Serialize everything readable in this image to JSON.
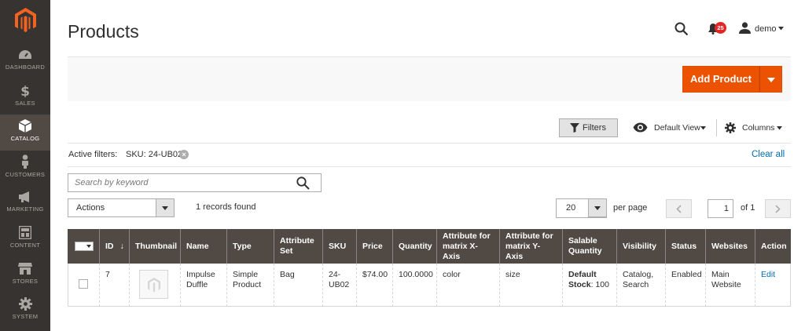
{
  "sidebar": {
    "items": [
      {
        "label": "DASHBOARD",
        "icon": "dashboard-icon"
      },
      {
        "label": "SALES",
        "icon": "dollar-icon"
      },
      {
        "label": "CATALOG",
        "icon": "cube-icon"
      },
      {
        "label": "CUSTOMERS",
        "icon": "person-icon"
      },
      {
        "label": "MARKETING",
        "icon": "megaphone-icon"
      },
      {
        "label": "CONTENT",
        "icon": "layout-icon"
      },
      {
        "label": "STORES",
        "icon": "store-icon"
      },
      {
        "label": "SYSTEM",
        "icon": "gear-icon"
      }
    ],
    "active": "CATALOG"
  },
  "header": {
    "title": "Products",
    "notifications_count": "25",
    "user_name": "demo"
  },
  "actionbar": {
    "add_label": "Add Product"
  },
  "toolbar": {
    "filters_label": "Filters",
    "view_label": "Default View",
    "columns_label": "Columns"
  },
  "active_filters": {
    "label": "Active filters:",
    "items": [
      "SKU: 24-UB02"
    ],
    "clear_label": "Clear all"
  },
  "search": {
    "placeholder": "Search by keyword",
    "value": ""
  },
  "mass_actions": {
    "label": "Actions"
  },
  "records_found": "1 records found",
  "pagination": {
    "per_page": "20",
    "per_page_label": "per page",
    "current_page": "1",
    "of_label": "of 1"
  },
  "table": {
    "columns": [
      "ID",
      "Thumbnail",
      "Name",
      "Type",
      "Attribute Set",
      "SKU",
      "Price",
      "Quantity",
      "Attribute for matrix X-Axis",
      "Attribute for matrix Y-Axis",
      "Salable Quantity",
      "Visibility",
      "Status",
      "Websites",
      "Action"
    ],
    "rows": [
      {
        "id": "7",
        "name": "Impulse Duffle",
        "type": "Simple Product",
        "attribute_set": "Bag",
        "sku": "24-UB02",
        "price": "$74.00",
        "quantity": "100.0000",
        "matrix_x": "color",
        "matrix_y": "size",
        "salable_label": "Default Stock",
        "salable_value": ": 100",
        "visibility": "Catalog, Search",
        "status": "Enabled",
        "websites": "Main Website",
        "action": "Edit"
      }
    ]
  },
  "colors": {
    "accent": "#eb5202",
    "sidebar_bg": "#373330",
    "header_bg": "#514943",
    "link": "#006bb4"
  }
}
